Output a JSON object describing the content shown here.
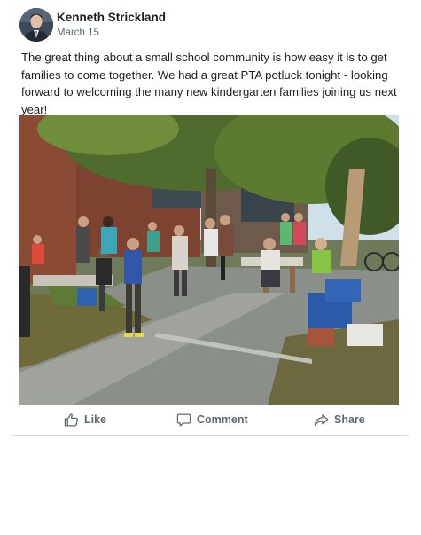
{
  "post": {
    "author": "Kenneth Strickland",
    "date": "March 15",
    "text": "The great thing about a small school community is how easy it is to get families to come together. We had a great PTA potluck tonight - looking forward to welcoming the many new kindergarten families joining us next year!"
  },
  "actions": {
    "like_label": "Like",
    "comment_label": "Comment",
    "share_label": "Share"
  },
  "icons": {
    "like": "thumbs-up-icon",
    "comment": "speech-bubble-icon",
    "share": "share-arrow-icon"
  },
  "colors": {
    "text": "#1c1e21",
    "muted": "#606770",
    "divider": "#dadde1"
  }
}
